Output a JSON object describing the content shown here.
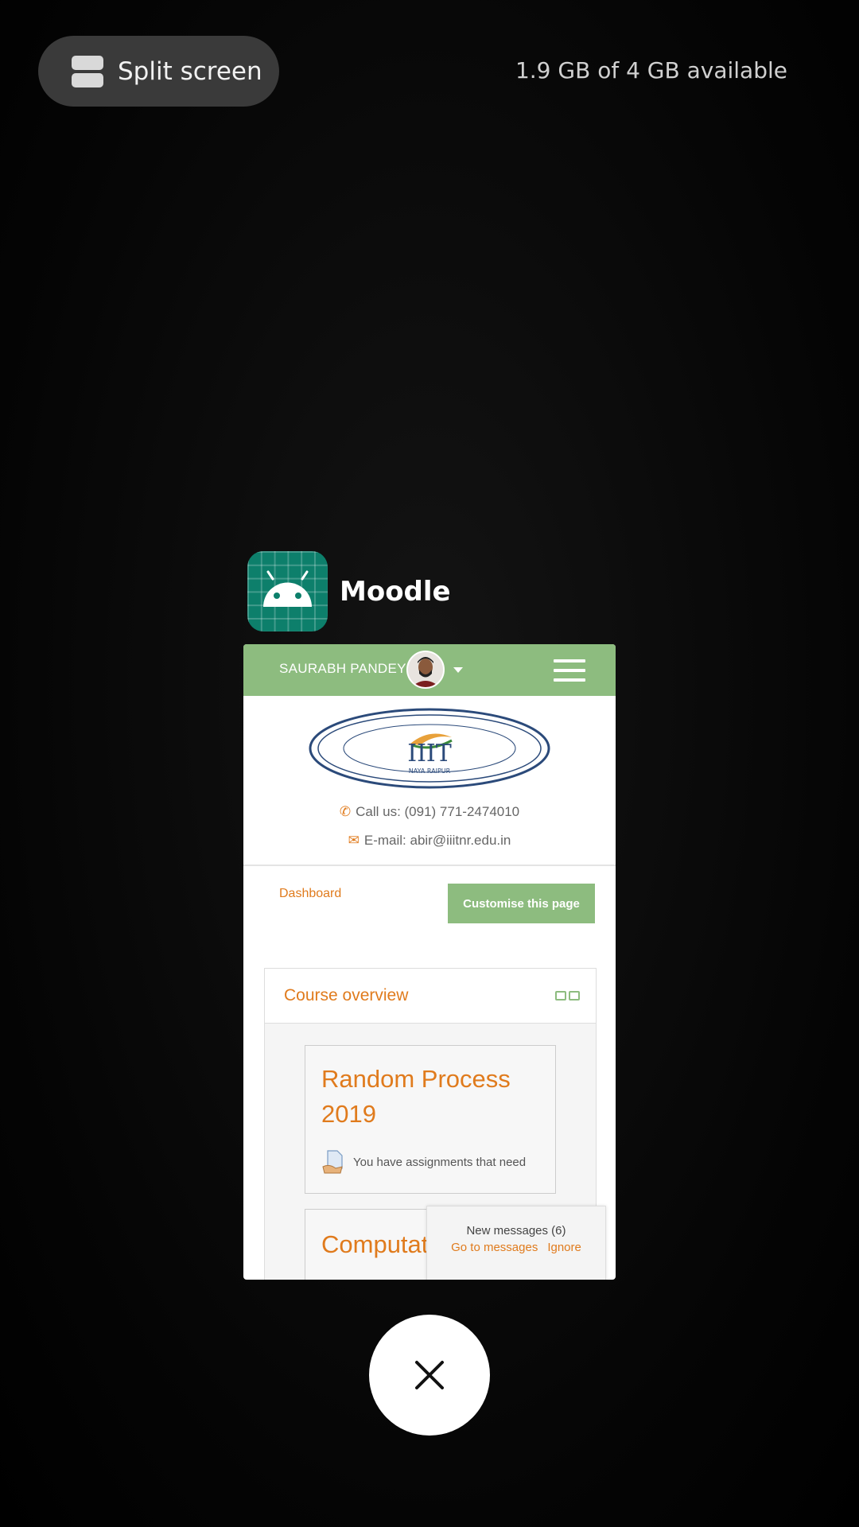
{
  "recents": {
    "split_screen_label": "Split screen",
    "memory_info": "1.9 GB of 4 GB available",
    "close_button_icon": "close-icon"
  },
  "app": {
    "name": "Moodle",
    "icon": "android-icon",
    "icon_color": "#0d7f6b"
  },
  "moodle": {
    "accent_color": "#e07b1d",
    "topbar_color": "#8dbc7f",
    "user_name": "SAURABH PANDEY",
    "logo": {
      "ring_text": "INTERNATIONAL INSTITUTE OF INFORMATION TECHNOLOGY",
      "main_text": "IIIT",
      "sub_text": "NAYA RAIPUR"
    },
    "contact": {
      "phone": "Call us: (091) 771-2474010",
      "email": "E-mail: abir@iiitnr.edu.in"
    },
    "nav": {
      "dashboard": "Dashboard",
      "customise": "Customise this page"
    },
    "course_overview": {
      "title": "Course overview",
      "courses": [
        {
          "title": "Random Process 2019",
          "note": "You have assignments that need"
        },
        {
          "title": "Computational Intelligence"
        }
      ]
    },
    "messages": {
      "title": "New messages (6)",
      "go": "Go to messages",
      "ignore": "Ignore"
    }
  }
}
